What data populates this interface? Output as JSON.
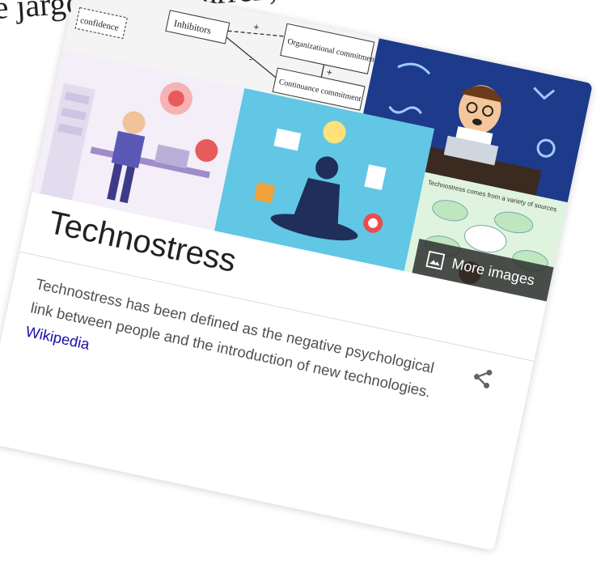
{
  "background": {
    "text": "e jargon te verwarren,"
  },
  "diagram": {
    "box_labels": [
      "Inhibitors",
      "Organizational commitment",
      "Continuance commitment",
      "confidence"
    ],
    "signs": [
      "+",
      "+",
      "-"
    ]
  },
  "more_images": {
    "label": "More images",
    "icon": "image-icon"
  },
  "card": {
    "title": "Technostress",
    "description": "Technostress has been defined as the negative psychological link between people and the introduction of new technologies.",
    "source_link": "Wikipedia",
    "share_icon": "share-icon"
  },
  "mindmap": {
    "header": "Technostress comes from a variety of sources"
  },
  "colors": {
    "link": "#1a0dab",
    "title": "#202124",
    "body": "#4d5156",
    "overlay": "#282828"
  }
}
